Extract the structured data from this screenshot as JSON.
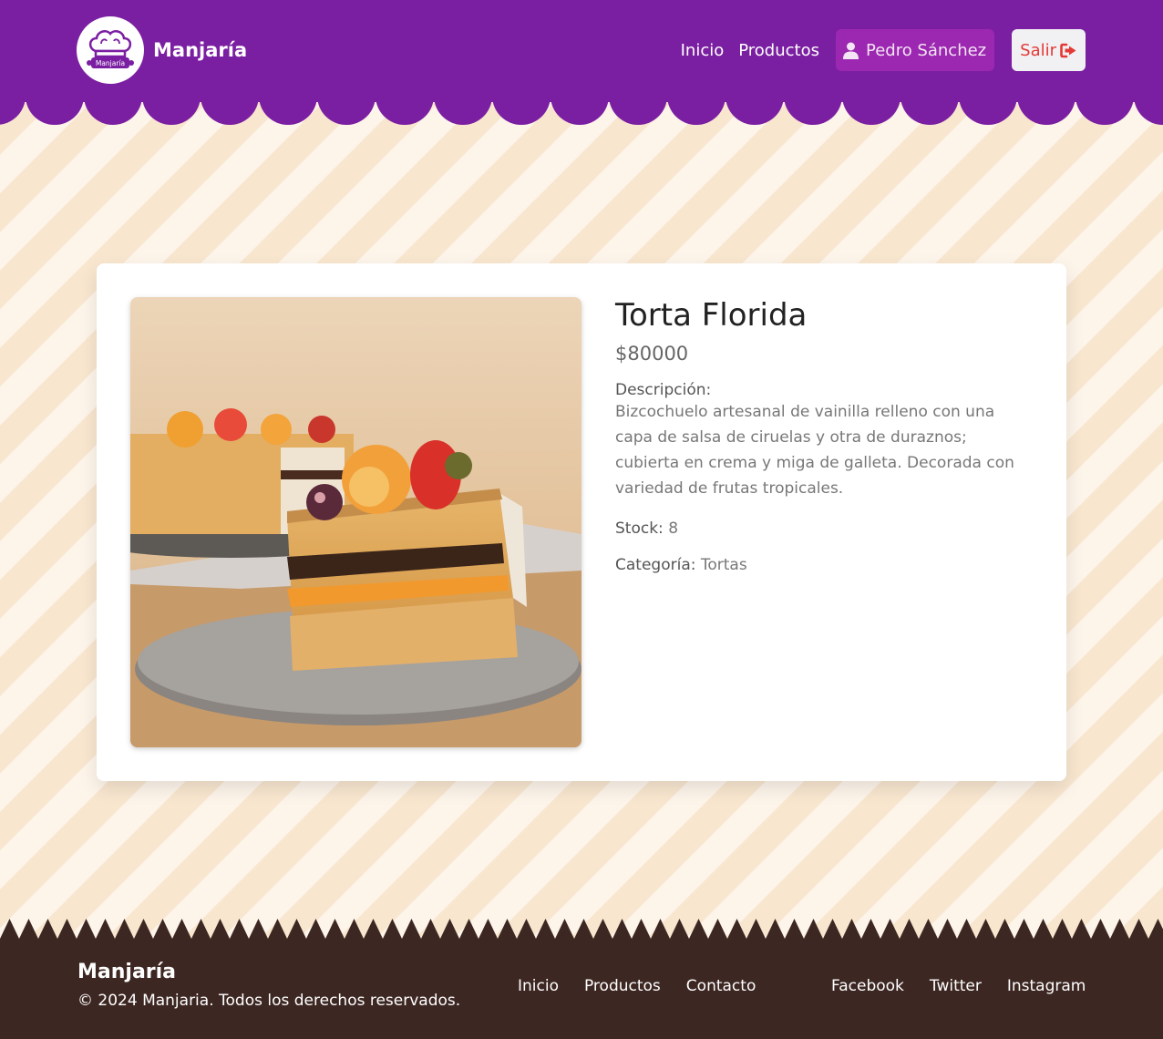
{
  "header": {
    "brand": "Manjaría",
    "logo_text": "Manjaría",
    "nav": [
      "Inicio",
      "Productos"
    ],
    "user_name": "Pedro Sánchez",
    "logout_label": "Salir"
  },
  "product": {
    "title": "Torta Florida",
    "price": "$80000",
    "description_label": "Descripción:",
    "description": "Bizcochuelo artesanal de vainilla relleno con una capa de salsa de ciruelas y otra de duraznos; cubierta en crema y miga de galleta. Decorada con variedad de frutas tropicales.",
    "stock_label": "Stock:",
    "stock_value": "8",
    "category_label": "Categoría:",
    "category_value": "Tortas"
  },
  "footer": {
    "brand": "Manjaría",
    "copyright": "© 2024 Manjaria. Todos los derechos reservados.",
    "nav": [
      "Inicio",
      "Productos",
      "Contacto"
    ],
    "social": [
      "Facebook",
      "Twitter",
      "Instagram"
    ]
  },
  "colors": {
    "header_bg": "#7b1fa2",
    "user_button_bg": "#9c27b0",
    "logout_text": "#e53935",
    "footer_bg": "#3d2722",
    "stripe_light": "#fdf4ea",
    "stripe_dark": "#f8e6cf"
  }
}
